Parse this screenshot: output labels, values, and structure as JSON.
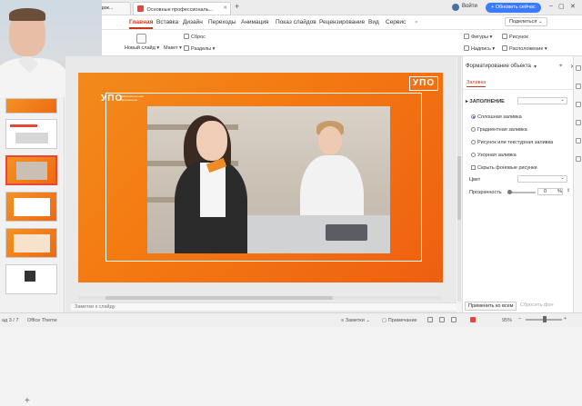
{
  "titlebar": {
    "tab1": "продаж...",
    "tab2": "Основные профессиональ...",
    "login": "Войти",
    "update": "+ Обновить сейчас"
  },
  "menu": [
    "Главная",
    "Вставка",
    "Дизайн",
    "Переходы",
    "Анимация",
    "Показ слайдов",
    "Рецензирование",
    "Вид",
    "Сервис"
  ],
  "share": "Поделиться",
  "ribbon": {
    "reset": "Сброс",
    "new_slide": "Новый слайд",
    "layout": "Макет",
    "sections": "Разделы",
    "shapes": "Фигуры",
    "picture": "Рисунок",
    "textbox": "Надпись",
    "arrange": "Расположение"
  },
  "slide": {
    "logo": "УПО",
    "logo_sub": "Образовательная Организация",
    "logo_right": "УПО"
  },
  "notes_placeholder": "Заметки к слайду",
  "panel": {
    "title": "Форматирование объекта",
    "tab": "Заливка",
    "section": "ЗАПОЛНЕНИЕ",
    "options": [
      "Сплошная заливка",
      "Градиентная заливка",
      "Рисунок или текстурная заливка",
      "Узорная заливка"
    ],
    "checkbox": "Скрыть фоновые рисунки",
    "color_label": "Цвет",
    "transparency_label": "Прозрачность",
    "transparency_value": "0",
    "transparency_unit": "%",
    "apply_all": "Применить ко всем",
    "reset_bg": "Сбросить фон"
  },
  "status": {
    "slide_info": "ад 3 / 7",
    "theme": "Office Theme",
    "notes": "Заметки",
    "comments": "Примечание",
    "zoom": "95%"
  },
  "colors": {
    "accent": "#c43b1c",
    "slide_orange": "#f47a12",
    "primary_button": "#3b7cff"
  }
}
